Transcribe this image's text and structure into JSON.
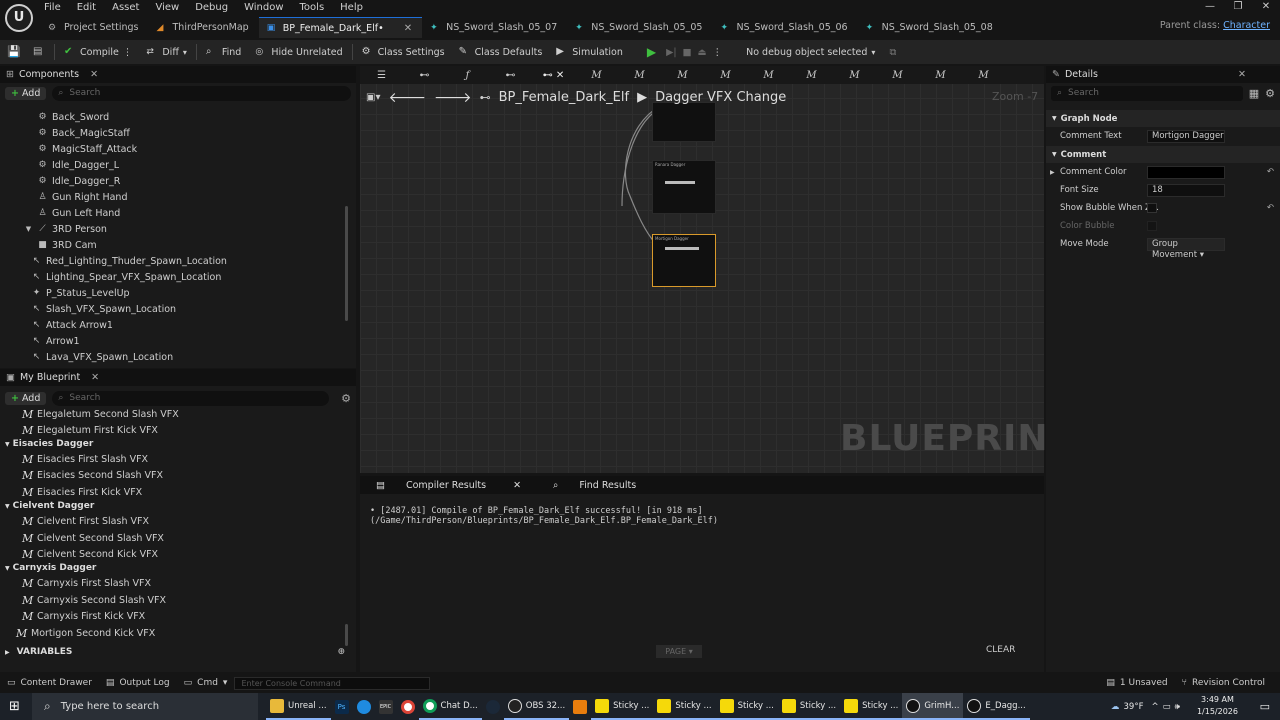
{
  "menu": [
    "File",
    "Edit",
    "Asset",
    "View",
    "Debug",
    "Window",
    "Tools",
    "Help"
  ],
  "logo": "U",
  "window_controls": [
    "—",
    "❐",
    "✕"
  ],
  "tabs": [
    {
      "label": "Project Settings",
      "active": false
    },
    {
      "label": "ThirdPersonMap",
      "active": false
    },
    {
      "label": "BP_Female_Dark_Elf•",
      "active": true
    },
    {
      "label": "NS_Sword_Slash_05_07",
      "active": false
    },
    {
      "label": "NS_Sword_Slash_05_05",
      "active": false
    },
    {
      "label": "NS_Sword_Slash_05_06",
      "active": false
    },
    {
      "label": "NS_Sword_Slash_05_08",
      "active": false
    }
  ],
  "parent_class": {
    "label": "Parent class:",
    "value": "Character"
  },
  "toolbar": {
    "compile": "Compile",
    "diff": "Diff",
    "find": "Find",
    "hide_unrelated": "Hide Unrelated",
    "class_settings": "Class Settings",
    "class_defaults": "Class Defaults",
    "simulation": "Simulation",
    "debug_object": "No debug object selected"
  },
  "components": {
    "title": "Components",
    "add": "Add",
    "search_placeholder": "Search",
    "items": [
      "Back_Sword",
      "Back_MagicStaff",
      "MagicStaff_Attack",
      "Idle_Dagger_L",
      "Idle_Dagger_R",
      "Gun Right Hand",
      "Gun Left Hand",
      "3RD Person",
      "3RD Cam",
      "Red_Lighting_Thuder_Spawn_Location",
      "Lighting_Spear_VFX_Spawn_Location",
      "P_Status_LevelUp",
      "Slash_VFX_Spawn_Location",
      "Attack Arrow1",
      "Arrow1",
      "Lava_VFX_Spawn_Location"
    ]
  },
  "my_blueprint": {
    "title": "My Blueprint",
    "add": "Add",
    "search_placeholder": "Search",
    "rows": [
      {
        "kind": "fn",
        "label": "Elegaletum Second Slash VFX"
      },
      {
        "kind": "fn",
        "label": "Elegaletum First Kick VFX"
      },
      {
        "kind": "cat",
        "label": "Eisacies Dagger"
      },
      {
        "kind": "fn",
        "label": "Eisacies First Slash VFX"
      },
      {
        "kind": "fn",
        "label": "Eisacies Second Slash VFX"
      },
      {
        "kind": "fn",
        "label": "Eisacies First Kick VFX"
      },
      {
        "kind": "cat",
        "label": "Cielvent Dagger"
      },
      {
        "kind": "fn",
        "label": "Cielvent First Slash VFX"
      },
      {
        "kind": "fn",
        "label": "Cielvent Second Slash VFX"
      },
      {
        "kind": "fn",
        "label": "Cielvent Second Kick VFX"
      },
      {
        "kind": "cat",
        "label": "Carnyxis Dagger"
      },
      {
        "kind": "fn",
        "label": "Carnyxis First Slash VFX"
      },
      {
        "kind": "fn",
        "label": "Carnyxis Second Slash VFX"
      },
      {
        "kind": "fn",
        "label": "Carnyxis First Kick VFX"
      },
      {
        "kind": "fn",
        "label": "Mortigon Second Kick VFX"
      }
    ],
    "variables": "VARIABLES"
  },
  "graph": {
    "breadcrumb_root": "BP_Female_Dark_Elf",
    "breadcrumb_current": "Dagger VFX Change",
    "zoom": "Zoom -7",
    "watermark": "BLUEPRINT",
    "tab_glyph": "M",
    "nodes": [
      "Ranara Dagger",
      "Mortigon Dagger"
    ]
  },
  "compiler": {
    "tab_results": "Compiler Results",
    "tab_find": "Find Results",
    "message": "[2487.01] Compile of BP_Female_Dark_Elf successful! [in 918 ms] (/Game/ThirdPerson/Blueprints/BP_Female_Dark_Elf.BP_Female_Dark_Elf)",
    "page": "PAGE",
    "clear": "CLEAR"
  },
  "details": {
    "title": "Details",
    "search_placeholder": "Search",
    "section_graph_node": "Graph Node",
    "comment_text_label": "Comment Text",
    "comment_text_value": "Mortigon Dagger",
    "section_comment": "Comment",
    "comment_color_label": "Comment Color",
    "font_size_label": "Font Size",
    "font_size_value": "18",
    "show_bubble_label": "Show Bubble When Z...",
    "color_bubble_label": "Color Bubble",
    "move_mode_label": "Move Mode",
    "move_mode_value": "Group Movement"
  },
  "statusbar": {
    "content_drawer": "Content Drawer",
    "output_log": "Output Log",
    "cmd": "Cmd",
    "console_placeholder": "Enter Console Command",
    "unsaved": "1 Unsaved",
    "revision_control": "Revision Control"
  },
  "taskbar": {
    "search_placeholder": "Type here to search",
    "apps": [
      "Unreal ...",
      "Ps",
      "",
      "EPIC",
      "",
      "Chat D...",
      "",
      "OBS 32...",
      "",
      "Sticky ...",
      "Sticky ...",
      "Sticky ...",
      "Sticky ...",
      "Sticky ...",
      "GrimH...",
      "E_Dagg..."
    ],
    "weather": "39°F",
    "time": "3:49 AM",
    "date": "1/15/2026"
  },
  "colors": {
    "accent": "#1e6fd9",
    "selection": "#d99a2b",
    "play": "#3fbf3f"
  }
}
